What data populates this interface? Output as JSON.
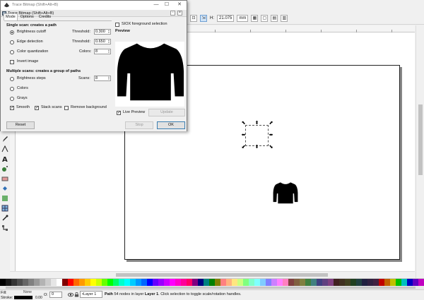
{
  "dialog": {
    "title": "Trace Bitmap (Shift+Alt+B)",
    "inner_title": "Trace Bitmap (Shift+Alt+B)",
    "tabs": [
      {
        "label": "Mode",
        "active": true
      },
      {
        "label": "Options",
        "active": false
      },
      {
        "label": "Credits",
        "active": false
      }
    ],
    "single_scan_title": "Single scan: creates a path",
    "brightness_cutoff": {
      "label": "Brightness cutoff",
      "selected": true,
      "threshold_label": "Threshold:",
      "threshold_value": "0.300"
    },
    "edge_detection": {
      "label": "Edge detection",
      "selected": false,
      "threshold_label": "Threshold:",
      "threshold_value": "0.650"
    },
    "color_quantization": {
      "label": "Color quantization",
      "selected": false,
      "colors_label": "Colors:",
      "colors_value": "8"
    },
    "invert_image": {
      "label": "Invert image",
      "checked": false
    },
    "multiple_scans_title": "Multiple scans: creates a group of paths",
    "brightness_steps": {
      "label": "Brightness steps",
      "selected": false,
      "scans_label": "Scans:",
      "scans_value": "8"
    },
    "colors": {
      "label": "Colors",
      "selected": false
    },
    "grays": {
      "label": "Grays",
      "selected": false
    },
    "smooth": {
      "label": "Smooth",
      "checked": true
    },
    "stack_scans": {
      "label": "Stack scans",
      "checked": true
    },
    "remove_background": {
      "label": "Remove background",
      "checked": false
    },
    "siox": {
      "label": "SIOX foreground selection",
      "checked": false
    },
    "preview_title": "Preview",
    "live_preview": {
      "label": "Live Preview",
      "checked": true
    },
    "update_label": "Update",
    "reset_label": "Reset",
    "stop_label": "Stop",
    "ok_label": "OK",
    "check_mark": "✓"
  },
  "tool_controls": {
    "h_label": "H:",
    "h_value": "21.075",
    "unit": "mm"
  },
  "statusbar": {
    "fill_label": "Fill:",
    "stroke_label": "Stroke:",
    "none_label": "None",
    "stroke_width": "0.00",
    "opacity_label": "O:",
    "opacity_value": "0",
    "layer_value": "•Layer 1",
    "message_object": "Path",
    "message_middle": " 54 nodes in layer ",
    "message_layer": "Layer 1",
    "message_end": ". Click selection to toggle scale/rotation handles."
  },
  "colors": {
    "accent": "#3c7fb1",
    "sweater": "#000000",
    "palette": [
      "#000000",
      "#1a1a1a",
      "#333333",
      "#4d4d4d",
      "#666666",
      "#808080",
      "#999999",
      "#b3b3b3",
      "#cccccc",
      "#e6e6e6",
      "#ffffff",
      "#800000",
      "#ff0000",
      "#ff6600",
      "#ff9900",
      "#ffcc00",
      "#ffff00",
      "#ccff00",
      "#66ff00",
      "#00ff00",
      "#00ff66",
      "#00ffcc",
      "#00ffff",
      "#00ccff",
      "#0099ff",
      "#0066ff",
      "#0000ff",
      "#6600ff",
      "#9900ff",
      "#cc00ff",
      "#ff00ff",
      "#ff00cc",
      "#ff0099",
      "#ff0066",
      "#800080",
      "#000080",
      "#008080",
      "#008000",
      "#808000",
      "#ff8080",
      "#ffb380",
      "#ffe680",
      "#ccff80",
      "#80ff80",
      "#80ffcc",
      "#80ffff",
      "#80ccff",
      "#8080ff",
      "#cc80ff",
      "#ff80ff",
      "#ff80c0",
      "#804040",
      "#806040",
      "#808040",
      "#408040",
      "#408080",
      "#404080",
      "#604080",
      "#804080",
      "#402020",
      "#403020",
      "#404020",
      "#204020",
      "#204040",
      "#202040",
      "#302040",
      "#402040",
      "#c00000",
      "#c06000",
      "#c0c000",
      "#00c000",
      "#00c0c0",
      "#0000c0",
      "#6000c0",
      "#c000c0"
    ]
  }
}
